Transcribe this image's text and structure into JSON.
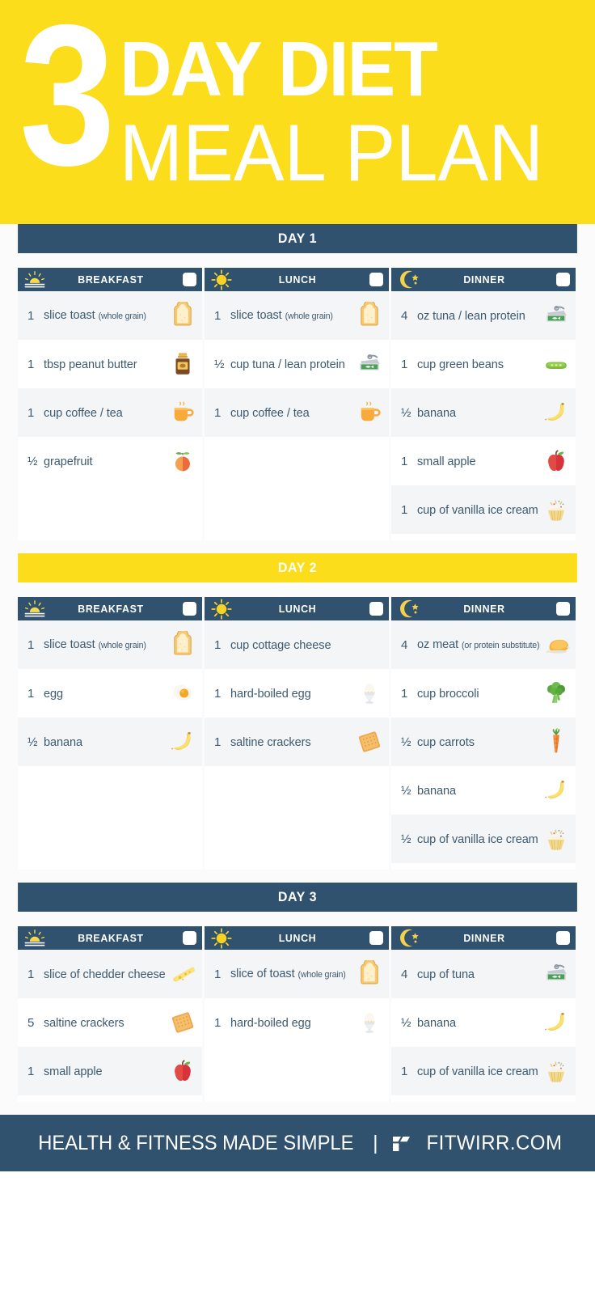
{
  "header": {
    "number": "3",
    "line1": "DAY DIET",
    "line2": "MEAL PLAN",
    "bg_color": "#fcdd1b",
    "text_color": "#ffffff"
  },
  "theme": {
    "navy": "#30526e",
    "yellow": "#fcdd1b",
    "row_alt": "#f4f5f7",
    "row_plain": "#ffffff",
    "text": "#3d5a70"
  },
  "days": [
    {
      "label": "DAY 1",
      "band_style": "navy",
      "meals": [
        {
          "title": "BREAKFAST",
          "icon": "sunrise-icon",
          "checkbox": "unchecked",
          "items": [
            {
              "qty": "1",
              "text": "slice toast",
              "note": "(whole grain)",
              "icon": "toast-icon"
            },
            {
              "qty": "1",
              "text": "tbsp peanut butter",
              "note": "",
              "icon": "peanut-butter-jar-icon"
            },
            {
              "qty": "1",
              "text": "cup coffee / tea",
              "note": "",
              "icon": "coffee-mug-icon"
            },
            {
              "qty": "½",
              "text": "grapefruit",
              "note": "",
              "icon": "grapefruit-icon"
            }
          ]
        },
        {
          "title": "LUNCH",
          "icon": "sun-icon",
          "checkbox": "unchecked",
          "items": [
            {
              "qty": "1",
              "text": "slice toast",
              "note": "(whole grain)",
              "icon": "toast-icon"
            },
            {
              "qty": "½",
              "text": "cup tuna / lean protein",
              "note": "",
              "icon": "tuna-can-icon"
            },
            {
              "qty": "1",
              "text": "cup coffee / tea",
              "note": "",
              "icon": "coffee-mug-icon"
            }
          ]
        },
        {
          "title": "DINNER",
          "icon": "moon-star-icon",
          "checkbox": "unchecked",
          "items": [
            {
              "qty": "4",
              "text": "oz tuna / lean protein",
              "note": "",
              "icon": "tuna-can-icon"
            },
            {
              "qty": "1",
              "text": "cup green beans",
              "note": "",
              "icon": "green-beans-icon"
            },
            {
              "qty": "½",
              "text": "banana",
              "note": "",
              "icon": "banana-icon"
            },
            {
              "qty": "1",
              "text": "small apple",
              "note": "",
              "icon": "apple-icon"
            },
            {
              "qty": "1",
              "text": "cup of vanilla ice cream",
              "note": "",
              "icon": "ice-cream-icon"
            }
          ]
        }
      ]
    },
    {
      "label": "DAY 2",
      "band_style": "yellow",
      "meals": [
        {
          "title": "BREAKFAST",
          "icon": "sunrise-icon",
          "checkbox": "unchecked",
          "items": [
            {
              "qty": "1",
              "text": "slice toast",
              "note": "(whole grain)",
              "icon": "toast-icon"
            },
            {
              "qty": "1",
              "text": "egg",
              "note": "",
              "icon": "fried-egg-icon"
            },
            {
              "qty": "½",
              "text": "banana",
              "note": "",
              "icon": "banana-icon"
            }
          ]
        },
        {
          "title": "LUNCH",
          "icon": "sun-icon",
          "checkbox": "unchecked",
          "items": [
            {
              "qty": "1",
              "text": "cup cottage cheese",
              "note": "",
              "icon": "none"
            },
            {
              "qty": "1",
              "text": "hard-boiled egg",
              "note": "",
              "icon": "boiled-egg-icon"
            },
            {
              "qty": "1",
              "text": "saltine crackers",
              "note": "",
              "icon": "cracker-icon"
            }
          ]
        },
        {
          "title": "DINNER",
          "icon": "moon-star-icon",
          "checkbox": "unchecked",
          "items": [
            {
              "qty": "4",
              "text": "oz meat",
              "note": "(or protein substitute)",
              "icon": "roast-chicken-icon"
            },
            {
              "qty": "1",
              "text": "cup broccoli",
              "note": "",
              "icon": "broccoli-icon"
            },
            {
              "qty": "½",
              "text": "cup carrots",
              "note": "",
              "icon": "carrot-icon"
            },
            {
              "qty": "½",
              "text": "banana",
              "note": "",
              "icon": "banana-icon"
            },
            {
              "qty": "½",
              "text": "cup of vanilla ice cream",
              "note": "",
              "icon": "ice-cream-icon"
            }
          ]
        }
      ]
    },
    {
      "label": "DAY 3",
      "band_style": "navy",
      "meals": [
        {
          "title": "BREAKFAST",
          "icon": "sunrise-icon",
          "checkbox": "unchecked",
          "items": [
            {
              "qty": "1",
              "text": "slice of chedder cheese",
              "note": "",
              "icon": "cheese-wedge-icon"
            },
            {
              "qty": "5",
              "text": "saltine crackers",
              "note": "",
              "icon": "cracker-icon"
            },
            {
              "qty": "1",
              "text": "small apple",
              "note": "",
              "icon": "apple-icon"
            }
          ]
        },
        {
          "title": "LUNCH",
          "icon": "sun-icon",
          "checkbox": "unchecked",
          "items": [
            {
              "qty": "1",
              "text": "slice of toast",
              "note": "(whole grain)",
              "icon": "toast-icon"
            },
            {
              "qty": "1",
              "text": "hard-boiled egg",
              "note": "",
              "icon": "boiled-egg-icon"
            }
          ]
        },
        {
          "title": "DINNER",
          "icon": "moon-star-icon",
          "checkbox": "unchecked",
          "items": [
            {
              "qty": "4",
              "text": "cup of tuna",
              "note": "",
              "icon": "tuna-can-icon"
            },
            {
              "qty": "½",
              "text": "banana",
              "note": "",
              "icon": "banana-icon"
            },
            {
              "qty": "1",
              "text": "cup of vanilla ice cream",
              "note": "",
              "icon": "ice-cream-icon"
            }
          ]
        }
      ]
    }
  ],
  "footer": {
    "tagline": "HEALTH & FITNESS MADE SIMPLE",
    "separator": "|",
    "logo": "fitwirr-f-logo-icon",
    "brand": "FITWIRR.COM"
  }
}
